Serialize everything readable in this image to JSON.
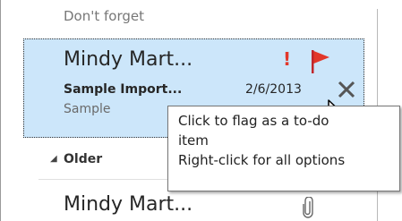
{
  "previous_item": {
    "preview": "Don't forget"
  },
  "selected_item": {
    "sender": "Mindy Mart...",
    "subject": "Sample Import...",
    "preview": "Sample",
    "date": "2/6/2013",
    "importance_glyph": "!",
    "colors": {
      "importance": "#e2372a",
      "flag": "#e2372a",
      "selection_bg": "#cce6fa"
    },
    "icons": [
      "high-importance-icon",
      "flag-icon",
      "delete-icon",
      "mouse-pointer-icon"
    ]
  },
  "tooltip": {
    "line1": "Click to flag as a to-do",
    "line2": "item",
    "line3": "Right-click for all options"
  },
  "group": {
    "toggle_glyph": "◢",
    "label": "Older"
  },
  "older_item": {
    "sender": "Mindy Mart...",
    "icons": [
      "attachment-icon"
    ]
  }
}
